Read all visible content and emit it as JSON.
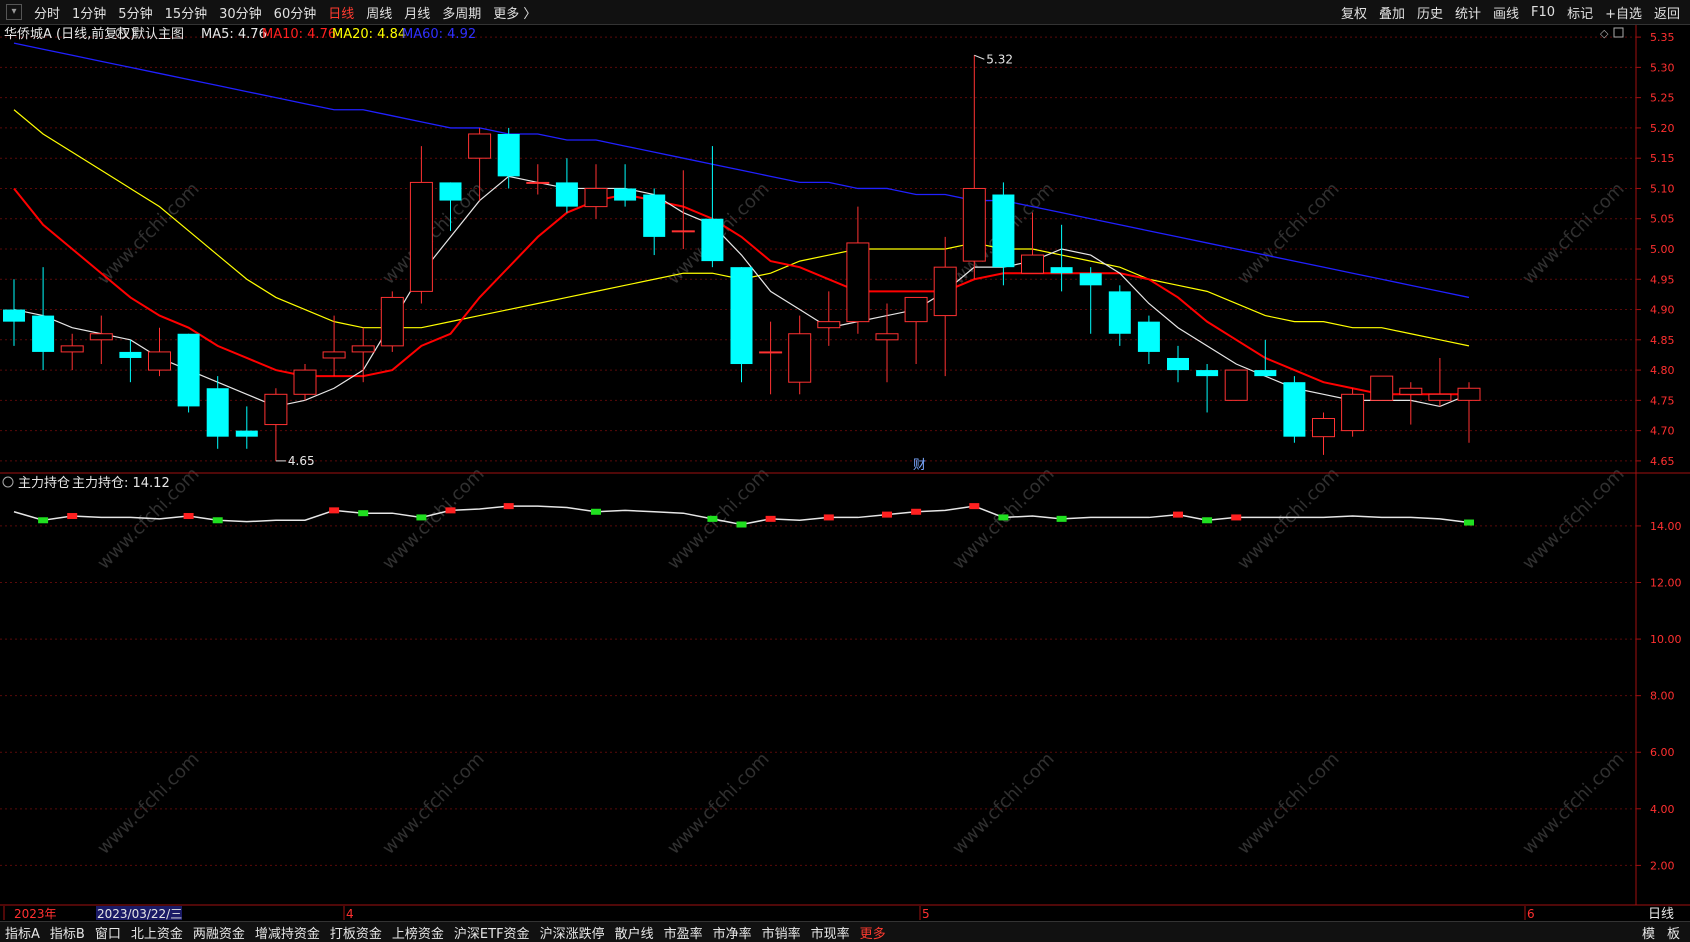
{
  "toolbar": {
    "periods": [
      "分时",
      "1分钟",
      "5分钟",
      "15分钟",
      "30分钟",
      "60分钟",
      "日线",
      "周线",
      "月线",
      "多周期",
      "更多 〉"
    ],
    "active_index": 6,
    "right": [
      "复权",
      "叠加",
      "历史",
      "统计",
      "画线",
      "F10",
      "标记",
      "+自选",
      "返回"
    ]
  },
  "main_chart": {
    "stock_label": "华侨城A (日线,前复权)",
    "template_label": "默认主图",
    "ma5_label": "MA5: 4.76",
    "ma10_label": "MA10: 4.76",
    "ma20_label": "MA20: 4.84",
    "ma60_label": "MA60: 4.92",
    "high_marker": "5.32",
    "low_marker": "4.65",
    "cai_marker": "财",
    "y_ticks": [
      "5.35",
      "5.30",
      "5.25",
      "5.20",
      "5.15",
      "5.10",
      "5.05",
      "5.00",
      "4.95",
      "4.90",
      "4.85",
      "4.80",
      "4.75",
      "4.70",
      "4.65"
    ]
  },
  "sub_chart": {
    "title": "主力持仓",
    "value_label": "主力持仓: 14.12",
    "y_ticks": [
      "14.00",
      "12.00",
      "10.00",
      "8.00",
      "6.00",
      "4.00",
      "2.00"
    ]
  },
  "x_axis": {
    "labels": [
      "2023年",
      "2023/03/22/三",
      "4",
      "5",
      "6"
    ],
    "period_label": "日线"
  },
  "bottom_tabs": [
    "指标A",
    "指标B",
    "窗口",
    "北上资金",
    "两融资金",
    "增减持资金",
    "打板资金",
    "上榜资金",
    "沪深ETF资金",
    "沪深涨跌停",
    "散户线",
    "市盈率",
    "市净率",
    "市销率",
    "市现率",
    "更多"
  ],
  "bottom_right": [
    "模",
    "板"
  ],
  "watermark": "www.cfchi.com",
  "colors": {
    "up": "#ff3232",
    "down": "#00ffff",
    "ma5": "#e6e6e6",
    "ma10": "#ff0000",
    "ma20": "#ffff00",
    "ma60": "#2020ff",
    "axis": "#a01010"
  },
  "chart_data": {
    "type": "candlestick",
    "candles": [
      {
        "o": 4.9,
        "h": 4.95,
        "l": 4.84,
        "c": 4.88
      },
      {
        "o": 4.89,
        "h": 4.97,
        "l": 4.8,
        "c": 4.83
      },
      {
        "o": 4.83,
        "h": 4.86,
        "l": 4.8,
        "c": 4.84
      },
      {
        "o": 4.85,
        "h": 4.89,
        "l": 4.81,
        "c": 4.86
      },
      {
        "o": 4.83,
        "h": 4.85,
        "l": 4.78,
        "c": 4.82
      },
      {
        "o": 4.8,
        "h": 4.87,
        "l": 4.79,
        "c": 4.83
      },
      {
        "o": 4.86,
        "h": 4.86,
        "l": 4.73,
        "c": 4.74
      },
      {
        "o": 4.77,
        "h": 4.79,
        "l": 4.67,
        "c": 4.69
      },
      {
        "o": 4.7,
        "h": 4.74,
        "l": 4.67,
        "c": 4.69
      },
      {
        "o": 4.71,
        "h": 4.77,
        "l": 4.65,
        "c": 4.76
      },
      {
        "o": 4.76,
        "h": 4.81,
        "l": 4.75,
        "c": 4.8
      },
      {
        "o": 4.82,
        "h": 4.89,
        "l": 4.79,
        "c": 4.83
      },
      {
        "o": 4.83,
        "h": 4.87,
        "l": 4.78,
        "c": 4.84
      },
      {
        "o": 4.84,
        "h": 4.93,
        "l": 4.83,
        "c": 4.92
      },
      {
        "o": 4.93,
        "h": 5.17,
        "l": 4.91,
        "c": 5.11
      },
      {
        "o": 5.11,
        "h": 5.11,
        "l": 5.03,
        "c": 5.08
      },
      {
        "o": 5.15,
        "h": 5.2,
        "l": 5.08,
        "c": 5.19
      },
      {
        "o": 5.19,
        "h": 5.2,
        "l": 5.1,
        "c": 5.12
      },
      {
        "o": 5.11,
        "h": 5.14,
        "l": 5.09,
        "c": 5.11
      },
      {
        "o": 5.11,
        "h": 5.15,
        "l": 5.06,
        "c": 5.07
      },
      {
        "o": 5.07,
        "h": 5.14,
        "l": 5.05,
        "c": 5.1
      },
      {
        "o": 5.1,
        "h": 5.14,
        "l": 5.07,
        "c": 5.08
      },
      {
        "o": 5.09,
        "h": 5.1,
        "l": 4.99,
        "c": 5.02
      },
      {
        "o": 5.03,
        "h": 5.13,
        "l": 5.0,
        "c": 5.03
      },
      {
        "o": 5.05,
        "h": 5.17,
        "l": 4.97,
        "c": 4.98
      },
      {
        "o": 4.97,
        "h": 4.97,
        "l": 4.78,
        "c": 4.81
      },
      {
        "o": 4.83,
        "h": 4.88,
        "l": 4.76,
        "c": 4.83
      },
      {
        "o": 4.78,
        "h": 4.89,
        "l": 4.76,
        "c": 4.86
      },
      {
        "o": 4.87,
        "h": 4.93,
        "l": 4.84,
        "c": 4.88
      },
      {
        "o": 4.88,
        "h": 5.07,
        "l": 4.86,
        "c": 5.01
      },
      {
        "o": 4.85,
        "h": 4.91,
        "l": 4.78,
        "c": 4.86
      },
      {
        "o": 4.88,
        "h": 4.92,
        "l": 4.81,
        "c": 4.92
      },
      {
        "o": 4.89,
        "h": 5.02,
        "l": 4.79,
        "c": 4.97
      },
      {
        "o": 4.98,
        "h": 5.32,
        "l": 4.95,
        "c": 5.1
      },
      {
        "o": 5.09,
        "h": 5.11,
        "l": 4.94,
        "c": 4.97
      },
      {
        "o": 4.96,
        "h": 5.06,
        "l": 4.96,
        "c": 4.99
      },
      {
        "o": 4.97,
        "h": 5.04,
        "l": 4.93,
        "c": 4.96
      },
      {
        "o": 4.96,
        "h": 4.97,
        "l": 4.86,
        "c": 4.94
      },
      {
        "o": 4.93,
        "h": 4.94,
        "l": 4.84,
        "c": 4.86
      },
      {
        "o": 4.88,
        "h": 4.89,
        "l": 4.81,
        "c": 4.83
      },
      {
        "o": 4.82,
        "h": 4.84,
        "l": 4.78,
        "c": 4.8
      },
      {
        "o": 4.8,
        "h": 4.81,
        "l": 4.73,
        "c": 4.79
      },
      {
        "o": 4.75,
        "h": 4.8,
        "l": 4.75,
        "c": 4.8
      },
      {
        "o": 4.8,
        "h": 4.85,
        "l": 4.79,
        "c": 4.79
      },
      {
        "o": 4.78,
        "h": 4.79,
        "l": 4.68,
        "c": 4.69
      },
      {
        "o": 4.69,
        "h": 4.73,
        "l": 4.66,
        "c": 4.72
      },
      {
        "o": 4.7,
        "h": 4.77,
        "l": 4.69,
        "c": 4.76
      },
      {
        "o": 4.75,
        "h": 4.79,
        "l": 4.75,
        "c": 4.79
      },
      {
        "o": 4.76,
        "h": 4.78,
        "l": 4.71,
        "c": 4.77
      },
      {
        "o": 4.75,
        "h": 4.82,
        "l": 4.74,
        "c": 4.76
      },
      {
        "o": 4.75,
        "h": 4.78,
        "l": 4.68,
        "c": 4.77
      }
    ],
    "ma5": [
      4.9,
      4.89,
      4.87,
      4.86,
      4.85,
      4.82,
      4.8,
      4.78,
      4.76,
      4.74,
      4.75,
      4.77,
      4.8,
      4.88,
      4.96,
      5.02,
      5.08,
      5.12,
      5.11,
      5.1,
      5.1,
      5.1,
      5.09,
      5.06,
      5.04,
      4.99,
      4.93,
      4.9,
      4.87,
      4.88,
      4.89,
      4.9,
      4.93,
      4.97,
      4.97,
      4.98,
      5.0,
      4.99,
      4.96,
      4.91,
      4.87,
      4.84,
      4.81,
      4.79,
      4.77,
      4.76,
      4.75,
      4.75,
      4.75,
      4.74,
      4.76
    ],
    "ma10": [
      5.1,
      5.04,
      5.0,
      4.96,
      4.92,
      4.89,
      4.87,
      4.84,
      4.82,
      4.8,
      4.79,
      4.79,
      4.79,
      4.8,
      4.84,
      4.86,
      4.92,
      4.97,
      5.02,
      5.06,
      5.08,
      5.09,
      5.08,
      5.07,
      5.05,
      5.02,
      4.98,
      4.97,
      4.95,
      4.93,
      4.93,
      4.93,
      4.93,
      4.95,
      4.96,
      4.96,
      4.96,
      4.96,
      4.96,
      4.95,
      4.92,
      4.88,
      4.85,
      4.82,
      4.8,
      4.78,
      4.77,
      4.76,
      4.76,
      4.76,
      4.76
    ],
    "ma20": [
      5.23,
      5.19,
      5.16,
      5.13,
      5.1,
      5.07,
      5.03,
      4.99,
      4.95,
      4.92,
      4.9,
      4.88,
      4.87,
      4.87,
      4.87,
      4.88,
      4.89,
      4.9,
      4.91,
      4.92,
      4.93,
      4.94,
      4.95,
      4.96,
      4.96,
      4.95,
      4.96,
      4.98,
      4.99,
      5.0,
      5.0,
      5.0,
      5.0,
      5.01,
      5.0,
      5.0,
      4.99,
      4.98,
      4.97,
      4.95,
      4.94,
      4.93,
      4.91,
      4.89,
      4.88,
      4.88,
      4.87,
      4.87,
      4.86,
      4.85,
      4.84
    ],
    "ma60": [
      5.34,
      5.33,
      5.32,
      5.31,
      5.3,
      5.29,
      5.28,
      5.27,
      5.26,
      5.25,
      5.24,
      5.23,
      5.23,
      5.22,
      5.21,
      5.2,
      5.2,
      5.19,
      5.19,
      5.18,
      5.18,
      5.17,
      5.16,
      5.15,
      5.14,
      5.13,
      5.12,
      5.11,
      5.11,
      5.1,
      5.1,
      5.09,
      5.09,
      5.08,
      5.08,
      5.07,
      5.06,
      5.05,
      5.04,
      5.03,
      5.02,
      5.01,
      5.0,
      4.99,
      4.98,
      4.97,
      4.96,
      4.95,
      4.94,
      4.93,
      4.92
    ],
    "holding": [
      14.5,
      14.2,
      14.35,
      14.3,
      14.3,
      14.25,
      14.35,
      14.2,
      14.15,
      14.2,
      14.2,
      14.55,
      14.45,
      14.45,
      14.3,
      14.55,
      14.6,
      14.7,
      14.7,
      14.65,
      14.5,
      14.55,
      14.5,
      14.45,
      14.25,
      14.05,
      14.25,
      14.2,
      14.3,
      14.3,
      14.4,
      14.5,
      14.55,
      14.7,
      14.3,
      14.35,
      14.25,
      14.3,
      14.3,
      14.3,
      14.4,
      14.2,
      14.3,
      14.3,
      14.3,
      14.3,
      14.35,
      14.3,
      14.3,
      14.25,
      14.12
    ],
    "main_ylim": [
      4.63,
      5.37
    ],
    "sub_ylim": [
      0.6,
      15.8
    ]
  }
}
